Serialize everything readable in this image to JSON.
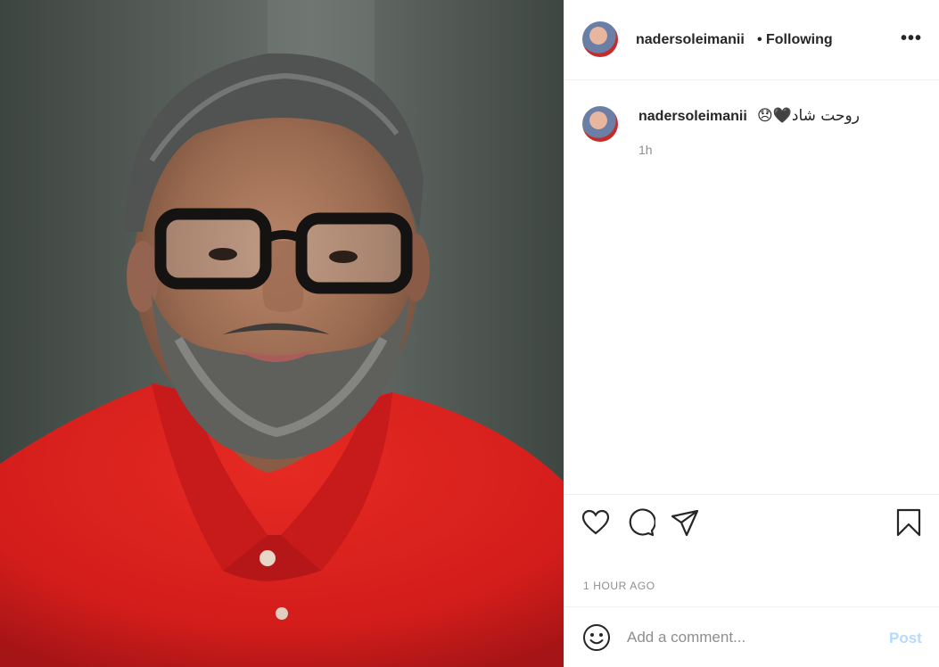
{
  "post": {
    "image_alt": "",
    "username": "nadersoleimanii",
    "separator": "•",
    "follow_status": "Following",
    "more_label": "•••",
    "caption": {
      "username": "nadersoleimanii",
      "text": "روحت شاد🖤😞",
      "age": "1h"
    },
    "timestamp": "1 HOUR AGO"
  },
  "icons": {
    "like": "heart-icon",
    "comment": "comment-bubble-icon",
    "share": "paper-plane-icon",
    "save": "bookmark-icon",
    "emoji": "smiley-icon",
    "more": "ellipsis-icon"
  },
  "comment_box": {
    "placeholder": "Add a comment...",
    "post_label": "Post"
  },
  "colors": {
    "text": "#262626",
    "muted": "#8e8e8e",
    "border": "#efefef",
    "post_disabled": "#b3dbff",
    "shirt": "#d61f1f"
  }
}
